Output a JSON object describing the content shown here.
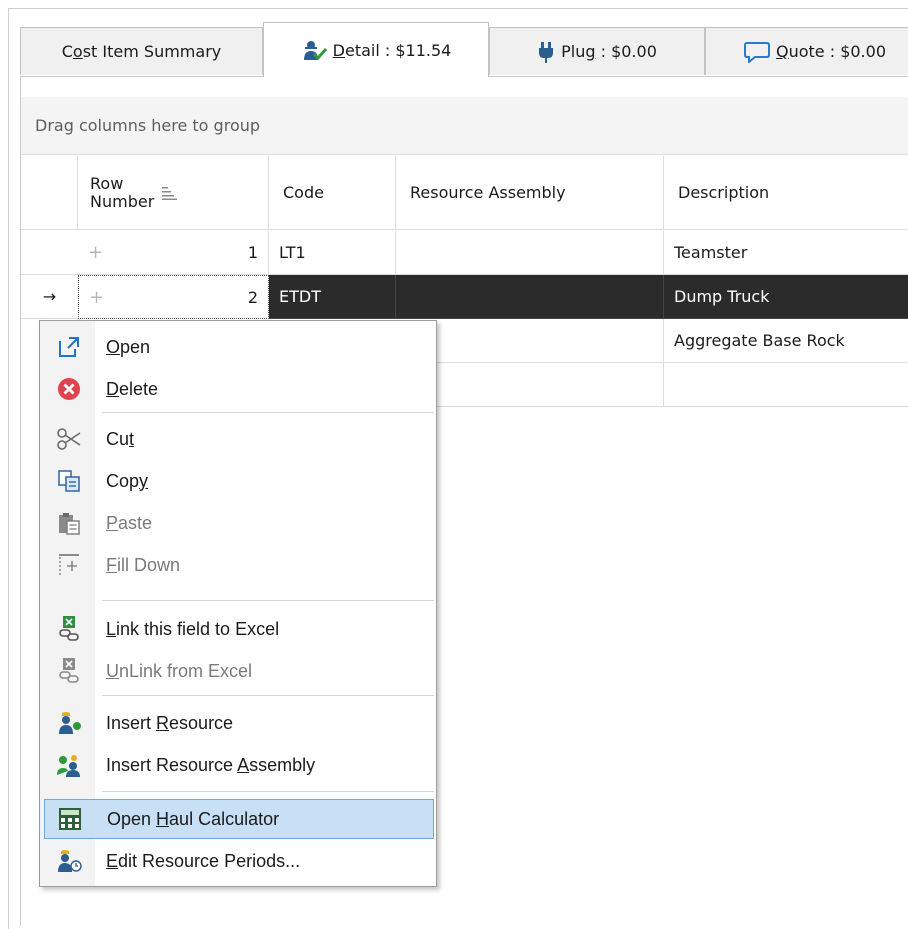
{
  "tabs": [
    {
      "label": "Cost Item Summary",
      "icon": null
    },
    {
      "label": "Detail : $11.54",
      "icon": "worker-check-icon"
    },
    {
      "label": "Plug : $0.00",
      "icon": "plug-icon"
    },
    {
      "label": "Quote : $0.00",
      "icon": "speech-bubble-icon"
    }
  ],
  "grid": {
    "group_hint": "Drag columns here to group",
    "columns": [
      "Row Number",
      "Code",
      "Resource Assembly",
      "Description"
    ],
    "rows": [
      {
        "row_number": "1",
        "code": "LT1",
        "resource_assembly": "",
        "description": "Teamster",
        "selected": false
      },
      {
        "row_number": "2",
        "code": "ETDT",
        "resource_assembly": "",
        "description": "Dump Truck",
        "selected": true
      },
      {
        "row_number": "",
        "code": "",
        "resource_assembly": "",
        "description": "Aggregate Base Rock",
        "selected": false
      },
      {
        "row_number": "",
        "code": "",
        "resource_assembly": "",
        "description": "",
        "selected": false
      }
    ],
    "current_row_indicator": "→"
  },
  "context_menu": {
    "items": [
      {
        "label": "Open",
        "icon": "open-external-icon",
        "enabled": true
      },
      {
        "label": "Delete",
        "icon": "delete-x-icon",
        "enabled": true
      },
      {
        "label": "Cut",
        "icon": "scissors-icon",
        "enabled": true
      },
      {
        "label": "Copy",
        "icon": "copy-icon",
        "enabled": true
      },
      {
        "label": "Paste",
        "icon": "paste-icon",
        "enabled": false
      },
      {
        "label": "Fill Down",
        "icon": "fill-down-icon",
        "enabled": false
      },
      {
        "label": "Link this field to Excel",
        "icon": "excel-link-icon",
        "enabled": true
      },
      {
        "label": "UnLink from Excel",
        "icon": "excel-unlink-icon",
        "enabled": false
      },
      {
        "label": "Insert Resource",
        "icon": "insert-resource-icon",
        "enabled": true
      },
      {
        "label": "Insert Resource Assembly",
        "icon": "insert-assembly-icon",
        "enabled": true
      },
      {
        "label": "Open Haul Calculator",
        "icon": "calculator-icon",
        "enabled": true,
        "highlighted": true
      },
      {
        "label": "Edit Resource Periods...",
        "icon": "resource-periods-icon",
        "enabled": true
      }
    ]
  },
  "colors": {
    "selected_row_bg": "#2b2b2b",
    "menu_highlight": "#c7e0f6",
    "delete_red": "#e0434d",
    "excel_green": "#2f8f3f"
  }
}
